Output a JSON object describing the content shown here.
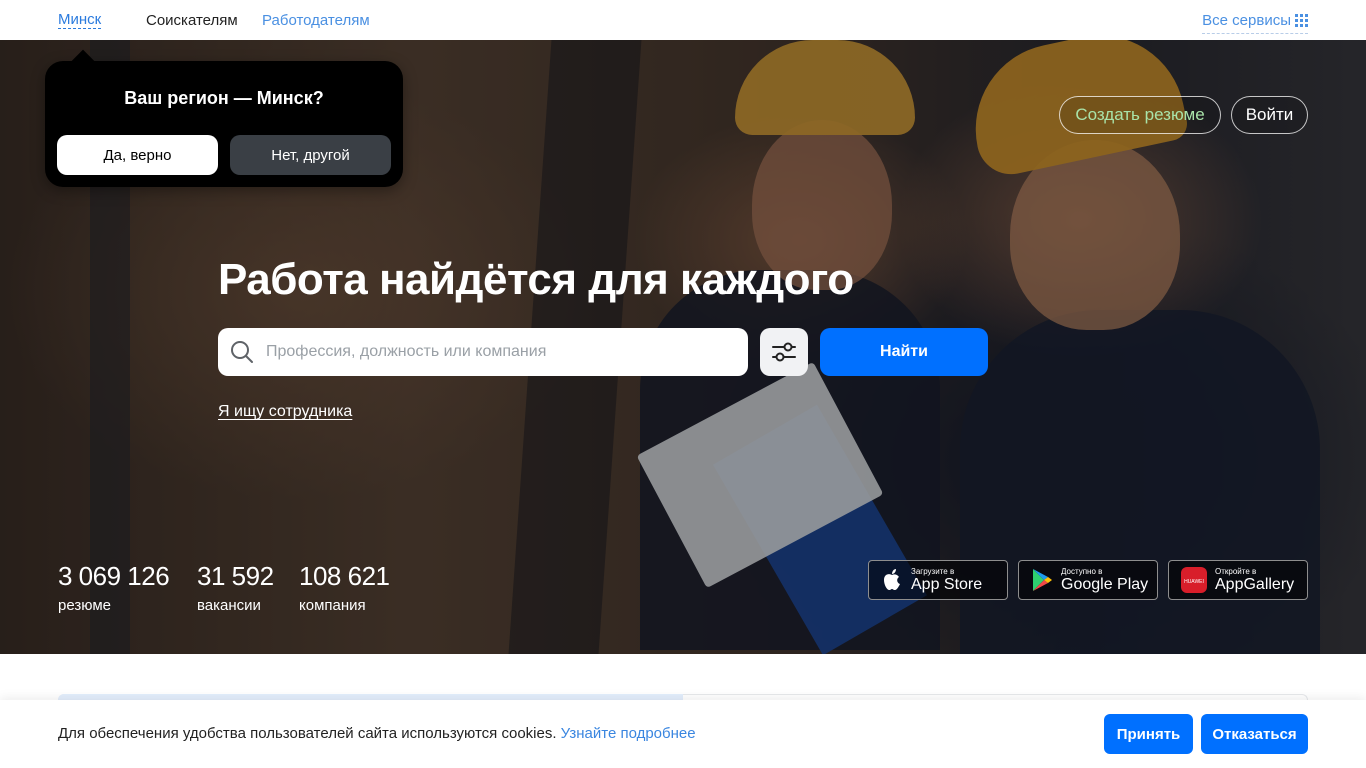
{
  "topbar": {
    "city": "Минск",
    "nav": {
      "seekers": "Соискателям",
      "employers": "Работодателям"
    },
    "all_services": "Все сервисы",
    "all_services_icon": "grid-icon"
  },
  "region_popup": {
    "question": "Ваш регион — Минск?",
    "yes": "Да, верно",
    "no": "Нет, другой"
  },
  "auth": {
    "create_resume": "Создать резюме",
    "login": "Войти"
  },
  "hero": {
    "headline": "Работа найдётся для каждого",
    "search": {
      "placeholder": "Профессия, должность или компания",
      "value": "",
      "icon": "search-icon"
    },
    "filter_icon": "filter-sliders-icon",
    "find_button": "Найти",
    "employer_link": "Я ищу сотрудника"
  },
  "stats": [
    {
      "value": "3 069 126",
      "label": "резюме"
    },
    {
      "value": "31 592",
      "label": "вакансии"
    },
    {
      "value": "108 621",
      "label": "компания"
    }
  ],
  "apps": [
    {
      "small": "Загрузите в",
      "big": "App Store",
      "icon": "apple-icon"
    },
    {
      "small": "Доступно в",
      "big": "Google Play",
      "icon": "google-play-icon"
    },
    {
      "small": "Откройте в",
      "big": "AppGallery",
      "icon": "huawei-appgallery-icon",
      "icon_text": "HUAWEI"
    }
  ],
  "cookie": {
    "text": "Для обеспечения удобства пользователей сайта используются cookies.",
    "link": "Узнайте подробнее",
    "accept": "Принять",
    "decline": "Отказаться"
  },
  "colors": {
    "accent": "#0070ff",
    "link": "#4a90e2",
    "resume_button_text": "#a9e3a9"
  }
}
